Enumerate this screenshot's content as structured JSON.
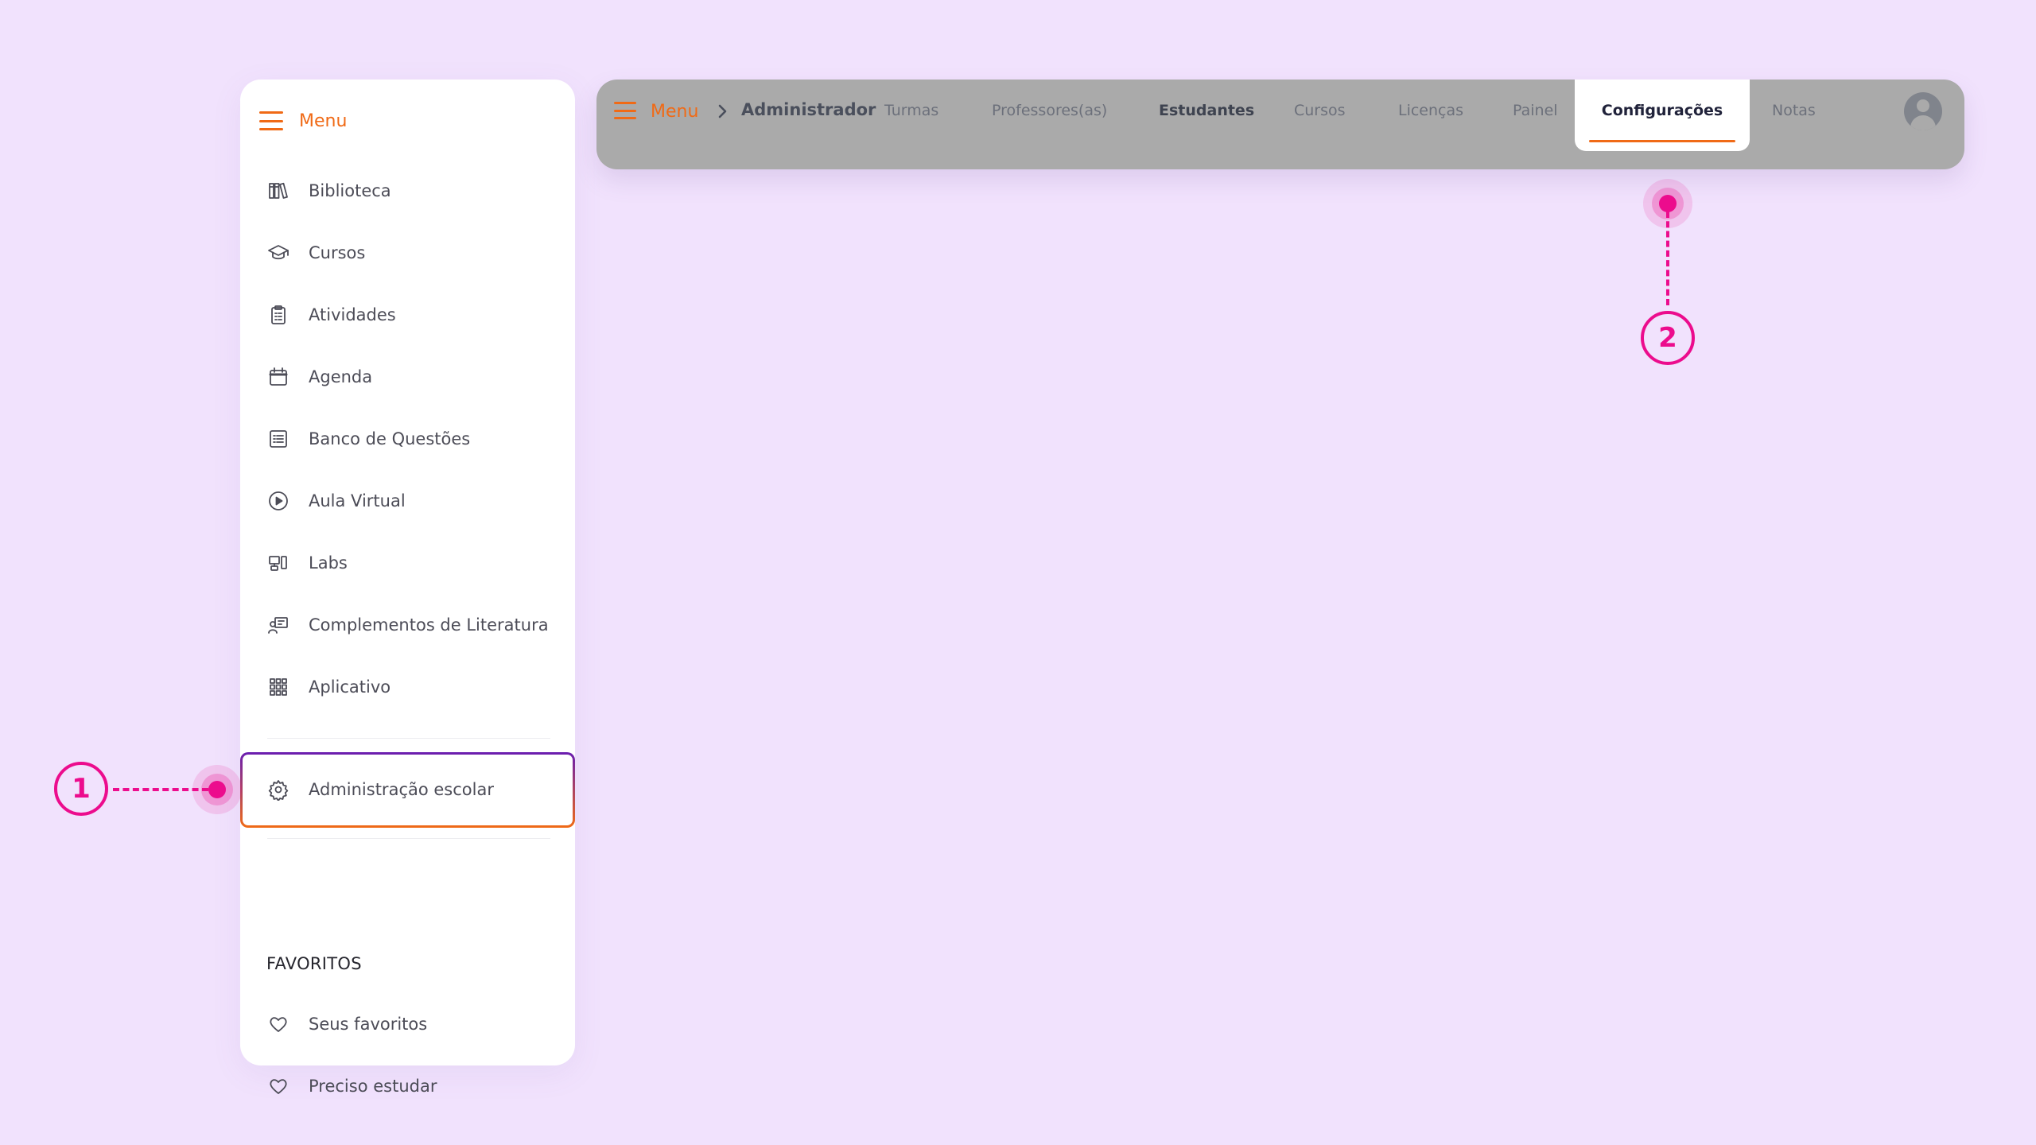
{
  "sidebar": {
    "menu_label": "Menu",
    "items": [
      {
        "label": "Biblioteca",
        "icon": "books-icon"
      },
      {
        "label": "Cursos",
        "icon": "graduation-cap-icon"
      },
      {
        "label": "Atividades",
        "icon": "clipboard-icon"
      },
      {
        "label": "Agenda",
        "icon": "calendar-icon"
      },
      {
        "label": "Banco de Questões",
        "icon": "list-icon"
      },
      {
        "label": "Aula Virtual",
        "icon": "play-circle-icon"
      },
      {
        "label": "Labs",
        "icon": "labs-icon"
      },
      {
        "label": "Complementos de Literatura",
        "icon": "presenter-icon"
      },
      {
        "label": "Aplicativo",
        "icon": "apps-grid-icon"
      }
    ],
    "admin_item": {
      "label": "Administração escolar",
      "icon": "gear-icon"
    },
    "favorites": {
      "title": "FAVORITOS",
      "items": [
        {
          "label": "Seus favoritos",
          "icon": "heart-icon"
        },
        {
          "label": "Preciso estudar",
          "icon": "heart-icon"
        }
      ]
    }
  },
  "topbar": {
    "menu_label": "Menu",
    "breadcrumb": "Administrador",
    "tabs": [
      {
        "label": "Turmas"
      },
      {
        "label": "Professores(as)"
      },
      {
        "label": "Estudantes"
      },
      {
        "label": "Cursos"
      },
      {
        "label": "Licenças"
      },
      {
        "label": "Painel"
      },
      {
        "label": "Configurações",
        "active": true
      },
      {
        "label": "Notas"
      }
    ],
    "avatar_icon": "user-avatar-icon"
  },
  "annotations": [
    {
      "number": "1"
    },
    {
      "number": "2"
    }
  ],
  "colors": {
    "background": "#f1e2fd",
    "accent_orange": "#f06a16",
    "annotation_pink": "#ec0c8d",
    "admin_border_top": "#6a1db0",
    "topbar_overlay": "#aaaaaa"
  }
}
